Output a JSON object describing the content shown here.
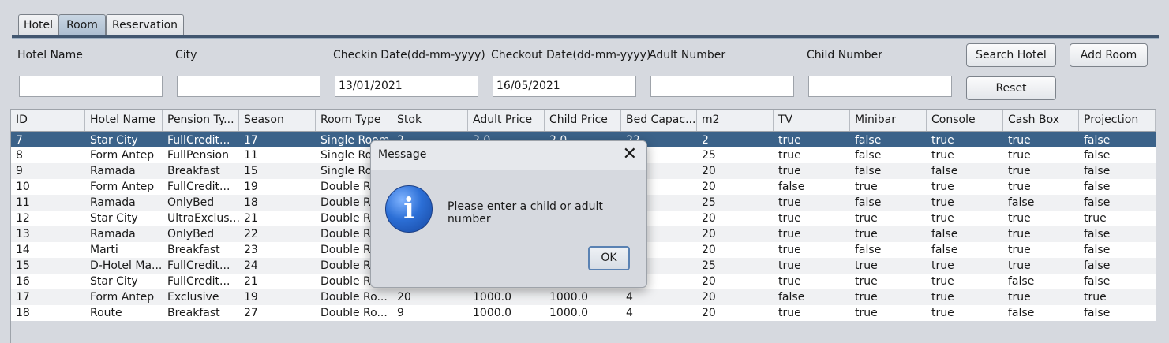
{
  "tabs": [
    "Hotel",
    "Room",
    "Reservation"
  ],
  "form": {
    "labels": {
      "hotel_name": "Hotel Name",
      "city": "City",
      "checkin": "Checkin Date(dd-mm-yyyy)",
      "checkout": "Checkout Date(dd-mm-yyyy)",
      "adult": "Adult Number",
      "child": "Child Number"
    },
    "values": {
      "hotel_name": "",
      "city": "",
      "checkin": "13/01/2021",
      "checkout": "16/05/2021",
      "adult": "",
      "child": ""
    },
    "buttons": {
      "search": "Search Hotel",
      "add_room": "Add Room",
      "reset": "Reset"
    }
  },
  "table": {
    "columns": [
      "ID",
      "Hotel Name",
      "Pension Ty...",
      "Season",
      "Room Type",
      "Stok",
      "Adult Price",
      "Child Price",
      "Bed Capac...",
      "m2",
      "TV",
      "Minibar",
      "Console",
      "Cash Box",
      "Projection"
    ],
    "rows": [
      [
        "7",
        "Star City",
        "FullCredit...",
        "17",
        "Single Room",
        "2",
        "2.0",
        "2.0",
        "22",
        "2",
        "true",
        "false",
        "true",
        "true",
        "false"
      ],
      [
        "8",
        "Form Antep",
        "FullPension",
        "11",
        "Single Ro",
        "",
        "",
        "",
        "",
        "25",
        "true",
        "false",
        "true",
        "true",
        "false"
      ],
      [
        "9",
        "Ramada",
        "Breakfast",
        "15",
        "Single Ro",
        "",
        "",
        "",
        "",
        "20",
        "true",
        "false",
        "false",
        "true",
        "false"
      ],
      [
        "10",
        "Form Antep",
        "FullCredit...",
        "19",
        "Double Ro",
        "",
        "",
        "",
        "",
        "20",
        "false",
        "true",
        "true",
        "true",
        "false"
      ],
      [
        "11",
        "Ramada",
        "OnlyBed",
        "18",
        "Double Ro",
        "",
        "",
        "",
        "",
        "25",
        "true",
        "false",
        "true",
        "false",
        "false"
      ],
      [
        "12",
        "Star City",
        "UltraExclus...",
        "21",
        "Double Ro",
        "",
        "",
        "",
        "",
        "20",
        "true",
        "true",
        "true",
        "true",
        "true"
      ],
      [
        "13",
        "Ramada",
        "OnlyBed",
        "22",
        "Double Ro",
        "",
        "",
        "",
        "",
        "20",
        "true",
        "true",
        "false",
        "true",
        "false"
      ],
      [
        "14",
        "Marti",
        "Breakfast",
        "23",
        "Double Ro",
        "",
        "",
        "",
        "",
        "20",
        "true",
        "false",
        "false",
        "true",
        "false"
      ],
      [
        "15",
        "D-Hotel Ma...",
        "FullCredit...",
        "24",
        "Double Ro",
        "",
        "",
        "",
        "",
        "25",
        "true",
        "true",
        "true",
        "true",
        "false"
      ],
      [
        "16",
        "Star City",
        "FullCredit...",
        "21",
        "Double Ro",
        "",
        "",
        "",
        "",
        "20",
        "true",
        "true",
        "true",
        "false",
        "false"
      ],
      [
        "17",
        "Form Antep",
        "Exclusive",
        "19",
        "Double Ro...",
        "20",
        "1000.0",
        "1000.0",
        "4",
        "20",
        "false",
        "true",
        "true",
        "true",
        "true"
      ],
      [
        "18",
        "Route",
        "Breakfast",
        "27",
        "Double Ro...",
        "9",
        "1000.0",
        "1000.0",
        "4",
        "20",
        "true",
        "true",
        "true",
        "false",
        "false"
      ]
    ],
    "selected_row": 0
  },
  "dialog": {
    "title": "Message",
    "close": "✕",
    "icon": "info-icon",
    "icon_glyph": "i",
    "message": "Please enter a child or adult number",
    "ok": "OK"
  }
}
